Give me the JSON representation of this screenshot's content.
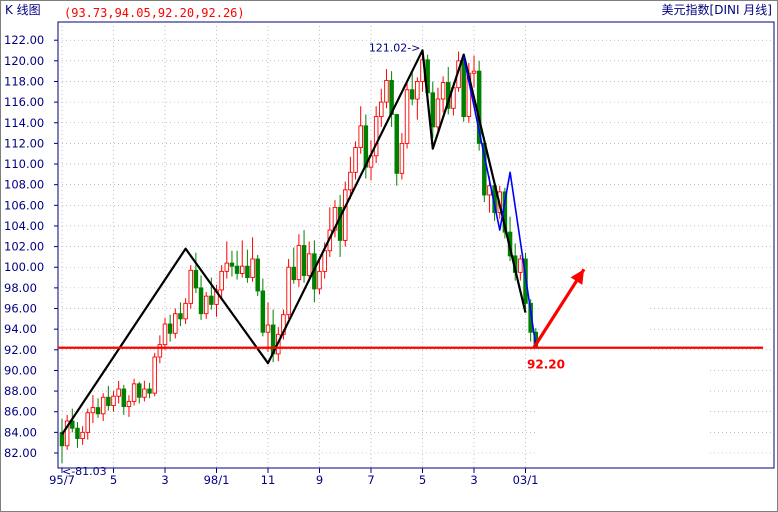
{
  "header": {
    "panel_title": "K 线图",
    "ohlc_readout": "(93.73,94.05,92.20,92.26)",
    "symbol_label": "美元指数[DINI 月线]"
  },
  "chart_data": {
    "type": "candlestick",
    "title": "",
    "xlabel": "",
    "ylabel": "",
    "ylim": [
      81,
      123
    ],
    "y_ticks": [
      82,
      84,
      86,
      88,
      90,
      92,
      94,
      96,
      98,
      100,
      102,
      104,
      106,
      108,
      110,
      112,
      114,
      116,
      118,
      120,
      122
    ],
    "y_tick_labels": [
      "82.00",
      "84.00",
      "86.00",
      "88.00",
      "90.00",
      "92.00",
      "94.00",
      "96.00",
      "98.00",
      "100.00",
      "102.00",
      "104.00",
      "106.00",
      "108.00",
      "110.00",
      "112.00",
      "114.00",
      "116.00",
      "118.00",
      "120.00",
      "122.00"
    ],
    "x_ticks": [
      {
        "label": "95/7",
        "index": 0
      },
      {
        "label": "5",
        "index": 10
      },
      {
        "label": "3",
        "index": 20
      },
      {
        "label": "98/1",
        "index": 30
      },
      {
        "label": "11",
        "index": 40
      },
      {
        "label": "9",
        "index": 50
      },
      {
        "label": "7",
        "index": 60
      },
      {
        "label": "5",
        "index": 70
      },
      {
        "label": "3",
        "index": 80
      },
      {
        "label": "03/1",
        "index": 90
      }
    ],
    "candles": [
      [
        84.0,
        85.3,
        81.0,
        82.7
      ],
      [
        82.7,
        85.7,
        82.3,
        85.1
      ],
      [
        85.1,
        86.3,
        84.0,
        84.4
      ],
      [
        84.4,
        85.0,
        82.5,
        83.4
      ],
      [
        83.4,
        84.6,
        82.8,
        84.0
      ],
      [
        84.0,
        86.3,
        83.3,
        85.9
      ],
      [
        85.9,
        87.6,
        84.9,
        86.4
      ],
      [
        86.4,
        87.3,
        85.4,
        85.8
      ],
      [
        85.8,
        87.8,
        85.1,
        87.4
      ],
      [
        87.4,
        88.5,
        86.1,
        86.6
      ],
      [
        86.6,
        88.0,
        86.0,
        87.5
      ],
      [
        87.5,
        89.0,
        86.8,
        88.2
      ],
      [
        88.2,
        88.6,
        85.7,
        86.5
      ],
      [
        86.5,
        87.6,
        85.5,
        87.0
      ],
      [
        87.0,
        89.2,
        86.6,
        88.7
      ],
      [
        88.7,
        88.9,
        86.8,
        87.4
      ],
      [
        87.4,
        89.0,
        87.0,
        88.2
      ],
      [
        88.2,
        88.8,
        87.3,
        87.8
      ],
      [
        87.8,
        91.7,
        87.5,
        91.3
      ],
      [
        91.3,
        93.4,
        90.7,
        92.5
      ],
      [
        92.5,
        95.1,
        92.0,
        94.5
      ],
      [
        94.5,
        95.4,
        92.8,
        93.6
      ],
      [
        93.6,
        96.0,
        93.1,
        95.5
      ],
      [
        95.5,
        96.6,
        94.3,
        95.0
      ],
      [
        95.0,
        97.0,
        94.5,
        96.5
      ],
      [
        96.5,
        100.2,
        96.0,
        99.7
      ],
      [
        99.7,
        101.4,
        97.5,
        98.0
      ],
      [
        98.0,
        99.2,
        94.9,
        95.5
      ],
      [
        95.5,
        97.6,
        95.0,
        97.2
      ],
      [
        97.2,
        99.0,
        95.9,
        96.4
      ],
      [
        96.4,
        98.3,
        95.2,
        97.8
      ],
      [
        97.8,
        100.2,
        97.0,
        99.6
      ],
      [
        99.6,
        102.5,
        98.9,
        100.4
      ],
      [
        100.4,
        101.6,
        99.1,
        100.1
      ],
      [
        100.1,
        101.6,
        98.8,
        99.4
      ],
      [
        99.4,
        102.6,
        99.0,
        100.1
      ],
      [
        100.1,
        101.7,
        98.5,
        99.0
      ],
      [
        99.0,
        102.9,
        98.6,
        100.8
      ],
      [
        100.8,
        101.2,
        97.2,
        97.7
      ],
      [
        97.7,
        98.9,
        93.3,
        93.7
      ],
      [
        93.7,
        96.6,
        91.8,
        94.4
      ],
      [
        94.4,
        95.9,
        90.8,
        91.6
      ],
      [
        91.6,
        94.2,
        90.9,
        93.5
      ],
      [
        93.5,
        95.9,
        93.0,
        95.4
      ],
      [
        95.4,
        100.8,
        95.0,
        100.0
      ],
      [
        100.0,
        101.9,
        98.4,
        98.8
      ],
      [
        98.8,
        103.2,
        98.1,
        102.1
      ],
      [
        102.1,
        103.6,
        98.5,
        99.2
      ],
      [
        99.2,
        102.5,
        98.6,
        101.3
      ],
      [
        101.3,
        102.6,
        96.6,
        97.9
      ],
      [
        97.9,
        101.0,
        97.4,
        99.6
      ],
      [
        99.6,
        102.4,
        98.9,
        101.6
      ],
      [
        101.6,
        105.8,
        101.0,
        103.6
      ],
      [
        103.6,
        106.5,
        102.9,
        105.8
      ],
      [
        105.8,
        107.0,
        101.0,
        102.6
      ],
      [
        102.6,
        108.3,
        102.0,
        107.5
      ],
      [
        107.5,
        110.7,
        106.6,
        109.2
      ],
      [
        109.2,
        112.2,
        108.5,
        111.6
      ],
      [
        111.6,
        115.6,
        111.0,
        113.7
      ],
      [
        113.7,
        114.8,
        108.6,
        109.7
      ],
      [
        109.7,
        112.3,
        108.4,
        110.8
      ],
      [
        110.8,
        115.6,
        110.1,
        114.6
      ],
      [
        114.6,
        117.3,
        113.6,
        116.0
      ],
      [
        116.0,
        119.2,
        115.4,
        118.1
      ],
      [
        118.1,
        119.0,
        113.6,
        114.8
      ],
      [
        114.8,
        114.6,
        107.9,
        109.1
      ],
      [
        109.1,
        113.0,
        108.5,
        112.0
      ],
      [
        112.0,
        117.9,
        111.5,
        117.2
      ],
      [
        117.2,
        119.1,
        115.7,
        116.3
      ],
      [
        116.3,
        118.4,
        114.3,
        118.0
      ],
      [
        118.0,
        121.0,
        117.0,
        120.1
      ],
      [
        120.1,
        120.6,
        116.0,
        116.9
      ],
      [
        116.9,
        118.0,
        112.5,
        113.6
      ],
      [
        113.6,
        117.4,
        113.0,
        116.3
      ],
      [
        116.3,
        118.5,
        115.0,
        117.9
      ],
      [
        117.9,
        119.4,
        114.8,
        115.4
      ],
      [
        115.4,
        117.9,
        114.7,
        117.4
      ],
      [
        117.4,
        120.9,
        117.0,
        120.0
      ],
      [
        120.0,
        120.2,
        114.1,
        114.6
      ],
      [
        114.6,
        119.8,
        114.0,
        118.8
      ],
      [
        118.8,
        120.5,
        117.4,
        119.0
      ],
      [
        119.0,
        120.0,
        111.3,
        112.0
      ],
      [
        112.0,
        112.6,
        106.3,
        107.0
      ],
      [
        107.0,
        108.8,
        105.3,
        107.9
      ],
      [
        107.9,
        108.4,
        104.5,
        105.3
      ],
      [
        105.3,
        107.9,
        104.7,
        107.3
      ],
      [
        107.3,
        107.7,
        102.8,
        103.4
      ],
      [
        103.4,
        104.9,
        100.6,
        101.1
      ],
      [
        101.1,
        102.3,
        98.7,
        99.5
      ],
      [
        99.5,
        101.2,
        98.7,
        100.8
      ],
      [
        100.8,
        101.4,
        96.0,
        96.5
      ],
      [
        96.5,
        96.9,
        92.8,
        93.7
      ],
      [
        93.7,
        94.1,
        92.2,
        92.3
      ]
    ],
    "point_annotations": [
      {
        "text": "121.02->",
        "index": 70,
        "value": 121.02
      },
      {
        "text": "<-81.03",
        "index": 0,
        "value": 81.03
      }
    ],
    "horizontal_line": {
      "value": 92.2,
      "label": "92.20",
      "color": "#ff0000"
    },
    "trend_lines_black": [
      [
        [
          0,
          83.8
        ],
        [
          24,
          101.8
        ],
        [
          40,
          90.7
        ],
        [
          70,
          121.02
        ],
        [
          72,
          111.5
        ],
        [
          78,
          120.6
        ],
        [
          90,
          95.6
        ]
      ]
    ],
    "trend_lines_blue": [
      [
        [
          78,
          120.4
        ],
        [
          85,
          103.6
        ],
        [
          87,
          109.2
        ],
        [
          92,
          92.4
        ]
      ]
    ],
    "arrow": {
      "from": [
        92,
        92.2
      ],
      "to": [
        100,
        99.8
      ],
      "color": "#ff0000"
    },
    "colors": {
      "up": "#ff0000",
      "down": "#008000",
      "axis": "#000080",
      "grid": "#999999",
      "readout": "#ff0000"
    }
  }
}
